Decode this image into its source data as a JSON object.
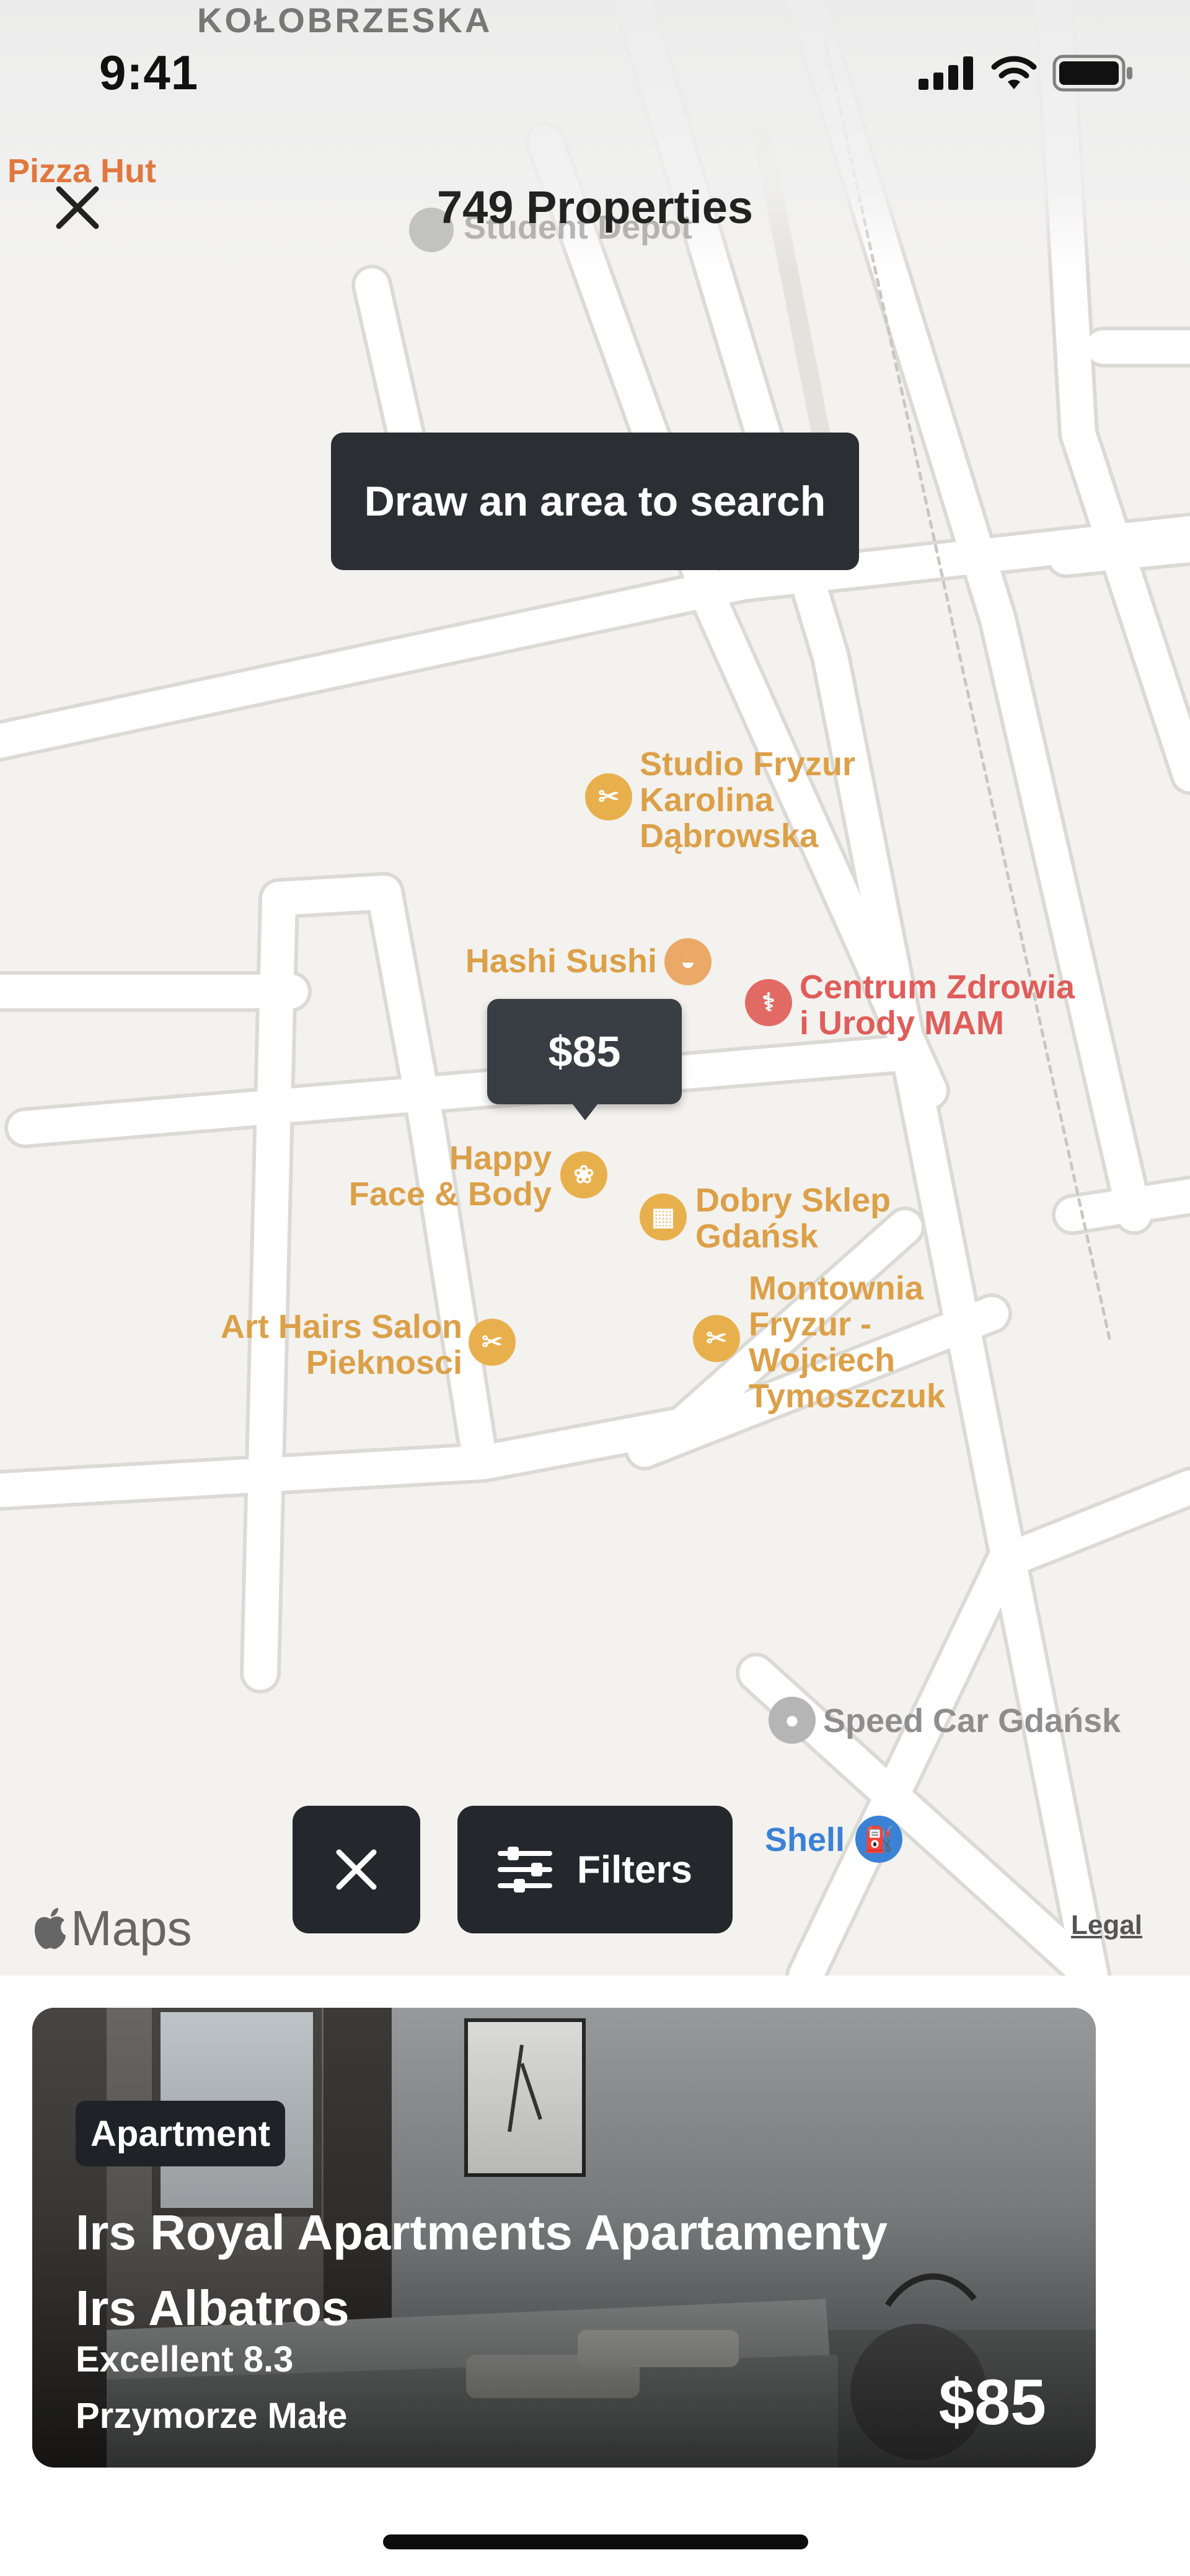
{
  "status_bar": {
    "time": "9:41"
  },
  "header": {
    "title": "749 Properties"
  },
  "map": {
    "draw_prompt": "Draw an area to search",
    "street_label": "KOŁOBRZESKA",
    "background_labels": {
      "pizza_hut": "Pizza Hut",
      "student_depot": "Student Depot"
    },
    "pois": {
      "studio_fryzur": "Studio Fryzur\nKarolina\nDąbrowska",
      "hashi_sushi": "Hashi Sushi",
      "centrum_zdrowia": "Centrum Zdrowia\ni Urody MAM",
      "happy_face": "Happy\nFace & Body",
      "dobry_sklep": "Dobry Sklep\nGdańsk",
      "art_hairs": "Art Hairs Salon\nPieknosci",
      "montownia": "Montownia\nFryzur -\nWojciech\nTymoszczuk",
      "speed_car": "Speed Car Gdańsk",
      "shell": "Shell"
    },
    "price_pin": "$85",
    "filters_label": "Filters",
    "maps_brand": "Maps",
    "legal": "Legal"
  },
  "card": {
    "type": "Apartment",
    "name": "Irs Royal Apartments Apartamenty Irs Albatros",
    "rating": "Excellent 8.3",
    "location": "Przymorze Małe",
    "price": "$85"
  },
  "colors": {
    "poi_orange": "#dca049",
    "poi_red": "#e05d5a",
    "shell_blue": "#3b82d6",
    "dark_ui": "#24282d"
  }
}
